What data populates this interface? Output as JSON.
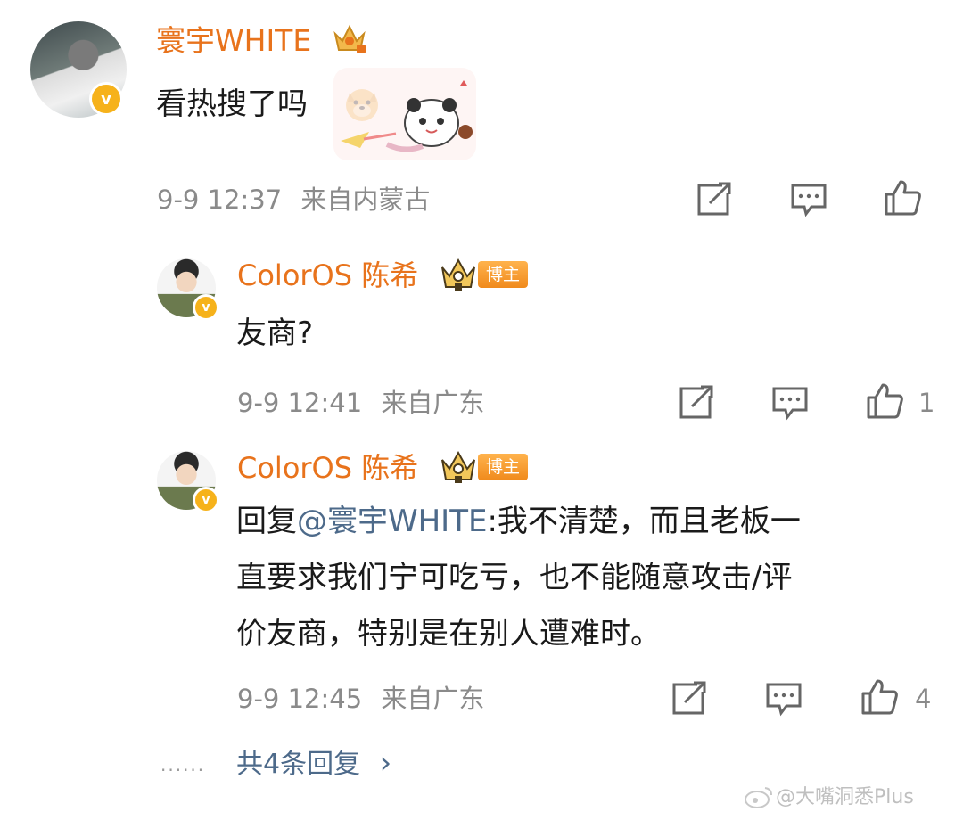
{
  "comment": {
    "username": "寰宇WHITE",
    "text": "看热搜了吗",
    "time": "9-9 12:37",
    "location": "来自内蒙古"
  },
  "replies": [
    {
      "username": "ColorOS 陈希",
      "badge": "博主",
      "text": "友商?",
      "time": "9-9 12:41",
      "location": "来自广东",
      "likes": "1"
    },
    {
      "username": "ColorOS 陈希",
      "badge": "博主",
      "reply_prefix": "回复",
      "mention": "@寰宇WHITE",
      "text_line1": ":我不清楚，而且老板一",
      "text_line2": "直要求我们宁可吃亏，也不能随意攻击/评",
      "text_line3": "价友商，特别是在别人遭难时。",
      "time": "9-9 12:45",
      "location": "来自广东",
      "likes": "4"
    }
  ],
  "more_replies": {
    "ellipsis": "......",
    "label": "共4条回复",
    "arrow": "›"
  },
  "watermark": "@大嘴洞悉Plus",
  "colors": {
    "username": "#e8731c",
    "meta": "#8a8a8a",
    "mention": "#4d6a8a",
    "verified": "#f6b21b"
  }
}
